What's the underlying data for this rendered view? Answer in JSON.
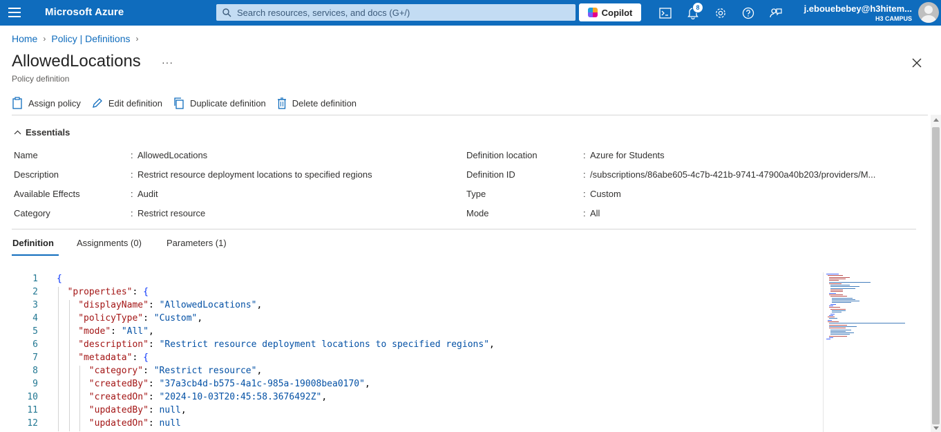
{
  "topbar": {
    "brand": "Microsoft Azure",
    "search_placeholder": "Search resources, services, and docs (G+/)",
    "copilot_label": "Copilot",
    "notification_count": "8",
    "user_name": "j.ebouebebey@h3hitem...",
    "user_org": "H3 CAMPUS"
  },
  "breadcrumb": [
    "Home",
    "Policy | Definitions"
  ],
  "page": {
    "title": "AllowedLocations",
    "subtitle": "Policy definition",
    "more": "···"
  },
  "toolbar": {
    "assign": "Assign policy",
    "edit": "Edit definition",
    "duplicate": "Duplicate definition",
    "delete": "Delete definition"
  },
  "essentials": {
    "heading": "Essentials",
    "left": [
      {
        "label": "Name",
        "value": "AllowedLocations"
      },
      {
        "label": "Description",
        "value": "Restrict resource deployment locations to specified regions"
      },
      {
        "label": "Available Effects",
        "value": "Audit"
      },
      {
        "label": "Category",
        "value": "Restrict resource"
      }
    ],
    "right": [
      {
        "label": "Definition location",
        "value": "Azure for Students"
      },
      {
        "label": "Definition ID",
        "value": "/subscriptions/86abe605-4c7b-421b-9741-47900a40b203/providers/M..."
      },
      {
        "label": "Type",
        "value": "Custom"
      },
      {
        "label": "Mode",
        "value": "All"
      }
    ]
  },
  "tabs": [
    "Definition",
    "Assignments (0)",
    "Parameters (1)"
  ],
  "active_tab": "Definition",
  "code_lines": [
    {
      "n": "1",
      "parts": [
        [
          "brace",
          "{"
        ]
      ]
    },
    {
      "n": "2",
      "parts": [
        [
          "key",
          "\"properties\""
        ],
        [
          "pun",
          ": "
        ],
        [
          "brace",
          "{"
        ]
      ]
    },
    {
      "n": "3",
      "parts": [
        [
          "key",
          "\"displayName\""
        ],
        [
          "pun",
          ": "
        ],
        [
          "str",
          "\"AllowedLocations\""
        ],
        [
          "pun",
          ","
        ]
      ]
    },
    {
      "n": "4",
      "parts": [
        [
          "key",
          "\"policyType\""
        ],
        [
          "pun",
          ": "
        ],
        [
          "str",
          "\"Custom\""
        ],
        [
          "pun",
          ","
        ]
      ]
    },
    {
      "n": "5",
      "parts": [
        [
          "key",
          "\"mode\""
        ],
        [
          "pun",
          ": "
        ],
        [
          "str",
          "\"All\""
        ],
        [
          "pun",
          ","
        ]
      ]
    },
    {
      "n": "6",
      "parts": [
        [
          "key",
          "\"description\""
        ],
        [
          "pun",
          ": "
        ],
        [
          "str",
          "\"Restrict resource deployment locations to specified regions\""
        ],
        [
          "pun",
          ","
        ]
      ]
    },
    {
      "n": "7",
      "parts": [
        [
          "key",
          "\"metadata\""
        ],
        [
          "pun",
          ": "
        ],
        [
          "brace",
          "{"
        ]
      ]
    },
    {
      "n": "8",
      "parts": [
        [
          "key",
          "\"category\""
        ],
        [
          "pun",
          ": "
        ],
        [
          "str",
          "\"Restrict resource\""
        ],
        [
          "pun",
          ","
        ]
      ]
    },
    {
      "n": "9",
      "parts": [
        [
          "key",
          "\"createdBy\""
        ],
        [
          "pun",
          ": "
        ],
        [
          "str",
          "\"37a3cb4d-b575-4a1c-985a-19008bea0170\""
        ],
        [
          "pun",
          ","
        ]
      ]
    },
    {
      "n": "10",
      "parts": [
        [
          "key",
          "\"createdOn\""
        ],
        [
          "pun",
          ": "
        ],
        [
          "str",
          "\"2024-10-03T20:45:58.3676492Z\""
        ],
        [
          "pun",
          ","
        ]
      ]
    },
    {
      "n": "11",
      "parts": [
        [
          "key",
          "\"updatedBy\""
        ],
        [
          "pun",
          ": "
        ],
        [
          "kw",
          "null"
        ],
        [
          "pun",
          ","
        ]
      ]
    },
    {
      "n": "12",
      "parts": [
        [
          "key",
          "\"updatedOn\""
        ],
        [
          "pun",
          ": "
        ],
        [
          "kw",
          "null"
        ]
      ]
    }
  ]
}
